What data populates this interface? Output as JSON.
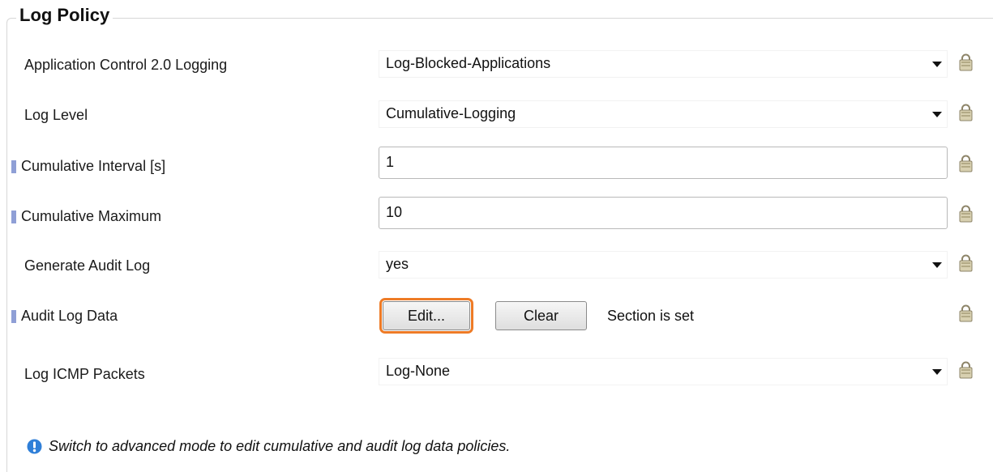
{
  "section": {
    "title": "Log Policy"
  },
  "rows": [
    {
      "label": "Application Control 2.0 Logging",
      "value": "Log-Blocked-Applications",
      "control": "dropdown"
    },
    {
      "label": "Log Level",
      "value": "Cumulative-Logging",
      "control": "dropdown"
    },
    {
      "label": "Cumulative Interval [s]",
      "value": "1",
      "control": "textbox"
    },
    {
      "label": "Cumulative Maximum",
      "value": "10",
      "control": "textbox"
    },
    {
      "label": "Generate Audit Log",
      "value": "yes",
      "control": "dropdown"
    },
    {
      "label": "Audit Log Data",
      "edit_button": "Edit...",
      "clear_button": "Clear",
      "status": "Section is set",
      "control": "buttons"
    },
    {
      "label": "Log ICMP Packets",
      "value": "Log-None",
      "control": "dropdown"
    }
  ],
  "info": {
    "icon": "info-icon",
    "text": "Switch to advanced mode to edit cumulative and audit log data policies."
  },
  "icons": {
    "lock": "lock-icon",
    "dropdown": "chevron-down-icon",
    "marker": "modified-marker"
  },
  "colors": {
    "focus_outline": "#ee7b26",
    "marker": "#8f9fd6",
    "info_icon": "#2f7fd8",
    "lock_body": "#cfc6a6"
  }
}
